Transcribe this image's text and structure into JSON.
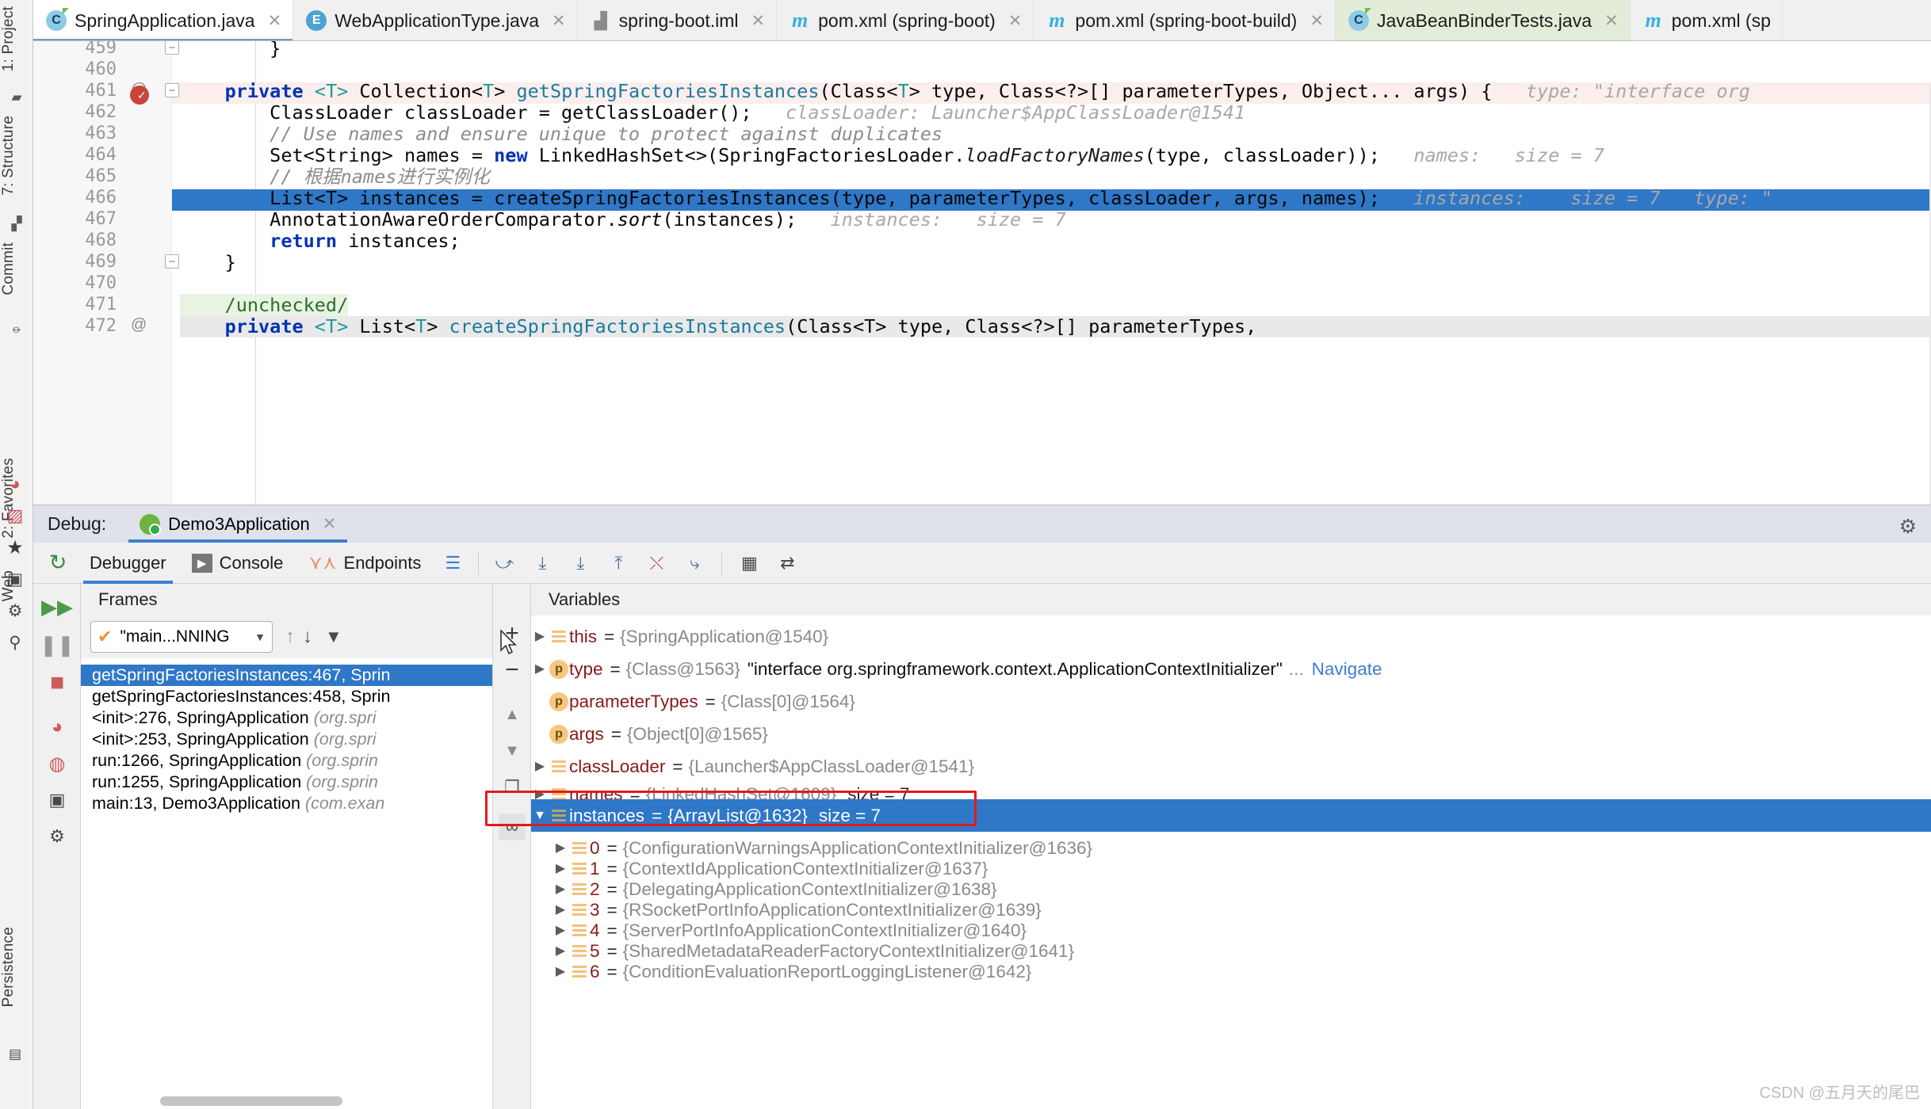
{
  "left_strip": {
    "items": [
      {
        "label": "1: Project",
        "icon": "folder-icon"
      },
      {
        "label": "7: Structure",
        "icon": "structure-icon"
      },
      {
        "label": "Commit",
        "icon": "commit-icon"
      }
    ],
    "bottom_items": [
      {
        "label": "2: Favorites",
        "icon": "star-icon"
      },
      {
        "label": "Web",
        "icon": "globe-icon"
      },
      {
        "label": "Persistence",
        "icon": "database-icon"
      }
    ],
    "bottom_icons": [
      "bug-icon",
      "coverage-icon",
      "star-icon",
      "camera-icon",
      "gear-icon",
      "pin-icon"
    ]
  },
  "tabs": [
    {
      "label": "SpringApplication.java",
      "icon": "java-class-icon",
      "active": true,
      "closable": true
    },
    {
      "label": "WebApplicationType.java",
      "icon": "java-enum-icon",
      "active": false,
      "closable": true
    },
    {
      "label": "spring-boot.iml",
      "icon": "module-icon",
      "active": false,
      "closable": true
    },
    {
      "label": "pom.xml (spring-boot)",
      "icon": "maven-icon",
      "active": false,
      "closable": true
    },
    {
      "label": "pom.xml (spring-boot-build)",
      "icon": "maven-icon",
      "active": false,
      "closable": true
    },
    {
      "label": "JavaBeanBinderTests.java",
      "icon": "java-class-icon",
      "active": false,
      "closable": true,
      "highlight": "green"
    },
    {
      "label": "pom.xml (sp",
      "icon": "maven-icon",
      "active": false,
      "closable": false
    }
  ],
  "editor": {
    "lines": [
      {
        "num": "459",
        "gutter": "",
        "fold": "minus",
        "text": "        }",
        "type": "plain"
      },
      {
        "num": "460",
        "gutter": "",
        "fold": "",
        "text": "",
        "type": "plain"
      },
      {
        "num": "461",
        "gutter": "@",
        "fold": "minus",
        "text": "    private <T> Collection<T> getSpringFactoriesInstances(Class<T> type, Class<?>[] parameterTypes, Object... args) {",
        "hint": "type:  \"interface org",
        "type": "code"
      },
      {
        "num": "462",
        "gutter": "breakpoint",
        "fold": "",
        "text": "        ClassLoader classLoader = getClassLoader();",
        "hint": "classLoader:  Launcher$AppClassLoader@1541",
        "type": "code",
        "rowbg": "#fbeeed"
      },
      {
        "num": "463",
        "gutter": "",
        "fold": "",
        "text": "        // Use names and ensure unique to protect against duplicates",
        "type": "comment"
      },
      {
        "num": "464",
        "gutter": "",
        "fold": "",
        "text": "        Set<String> names = new LinkedHashSet<>(SpringFactoriesLoader.loadFactoryNames(type, classLoader));",
        "hint": "names:   size = 7",
        "type": "code"
      },
      {
        "num": "465",
        "gutter": "",
        "fold": "",
        "text": "        // 根据names进行实例化",
        "type": "comment"
      },
      {
        "num": "466",
        "gutter": "",
        "fold": "",
        "text": "        List<T> instances = createSpringFactoriesInstances(type, parameterTypes, classLoader, args, names);",
        "hint": "instances:    size = 7   type: \"",
        "type": "code"
      },
      {
        "num": "467",
        "gutter": "",
        "fold": "",
        "text": "        AnnotationAwareOrderComparator.sort(instances);",
        "hint": "instances:   size = 7",
        "type": "code",
        "selected": true
      },
      {
        "num": "468",
        "gutter": "",
        "fold": "",
        "text": "        return instances;",
        "type": "code"
      },
      {
        "num": "469",
        "gutter": "",
        "fold": "minus",
        "text": "    }",
        "type": "plain"
      },
      {
        "num": "470",
        "gutter": "",
        "fold": "",
        "text": "",
        "type": "plain"
      },
      {
        "num": "471",
        "gutter": "",
        "fold": "",
        "text": "    /unchecked/",
        "type": "annotation"
      },
      {
        "num": "472",
        "gutter": "@",
        "fold": "",
        "text": "    private <T> List<T> createSpringFactoriesInstances(Class<T> type, Class<?>[] parameterTypes,",
        "type": "code"
      }
    ]
  },
  "debug": {
    "label": "Debug:",
    "session_tab": "Demo3Application",
    "gear_icon": "settings-gear-icon",
    "tabs": [
      {
        "label": "Debugger",
        "icon": "",
        "active": true
      },
      {
        "label": "Console",
        "icon": "console-icon",
        "active": false
      },
      {
        "label": "Endpoints",
        "icon": "endpoints-icon",
        "active": false
      }
    ],
    "toolbar_icons": [
      "layout-icon",
      "step-over-icon",
      "step-into-icon",
      "force-step-into-icon",
      "step-out-icon",
      "drop-frame-icon",
      "run-to-cursor-icon",
      "evaluate-icon",
      "settings-list-icon"
    ],
    "rail_icons": [
      "rerun-icon",
      "resume-icon",
      "pause-icon",
      "stop-icon",
      "view-breakpoints-icon",
      "mute-breakpoints-icon",
      "layout-settings-icon",
      "help-icon"
    ],
    "frames": {
      "title": "Frames",
      "thread": "\"main...NNING",
      "thread_check_icon": "check-icon",
      "dropdown_icon": "chevron-down-icon",
      "nav_icons": [
        "arrow-up-icon",
        "arrow-down-icon",
        "filter-icon"
      ],
      "items": [
        {
          "method": "getSpringFactoriesInstances:467, Sprin",
          "pkg": "",
          "selected": true
        },
        {
          "method": "getSpringFactoriesInstances:458, Sprin",
          "pkg": "",
          "selected": false
        },
        {
          "method": "<init>:276, SpringApplication ",
          "pkg": "(org.spri",
          "selected": false
        },
        {
          "method": "<init>:253, SpringApplication ",
          "pkg": "(org.spri",
          "selected": false
        },
        {
          "method": "run:1266, SpringApplication ",
          "pkg": "(org.sprin",
          "selected": false
        },
        {
          "method": "run:1255, SpringApplication ",
          "pkg": "(org.sprin",
          "selected": false
        },
        {
          "method": "main:13, Demo3Application ",
          "pkg": "(com.exan",
          "selected": false
        }
      ],
      "side_buttons": [
        "add-icon",
        "remove-icon",
        "move-up-icon",
        "move-down-icon",
        "copy-icon",
        "watch-icon"
      ]
    },
    "variables": {
      "title": "Variables",
      "rows": [
        {
          "indent": 0,
          "expandable": true,
          "expanded": false,
          "icon": "stack-icon",
          "name": "this",
          "value": "{SpringApplication@1540}"
        },
        {
          "indent": 0,
          "expandable": true,
          "expanded": false,
          "icon": "param-icon",
          "name": "type",
          "value": "{Class@1563}",
          "str": "\"interface org.springframework.context.ApplicationContextInitializer\"",
          "dots": "...",
          "link": "Navigate"
        },
        {
          "indent": 0,
          "expandable": false,
          "expanded": false,
          "icon": "param-icon",
          "name": "parameterTypes",
          "value": "{Class[0]@1564}"
        },
        {
          "indent": 0,
          "expandable": false,
          "expanded": false,
          "icon": "param-icon",
          "name": "args",
          "value": "{Object[0]@1565}"
        },
        {
          "indent": 0,
          "expandable": true,
          "expanded": false,
          "icon": "stack-icon",
          "name": "classLoader",
          "value": "{Launcher$AppClassLoader@1541}"
        },
        {
          "indent": 0,
          "expandable": true,
          "expanded": false,
          "icon": "stack-icon",
          "name": "names",
          "value": "{LinkedHashSet@1609}",
          "size": "size = 7"
        },
        {
          "indent": 0,
          "expandable": true,
          "expanded": true,
          "icon": "stack-icon",
          "name": "instances",
          "value": "{ArrayList@1632}",
          "size": "size = 7",
          "selected": true,
          "outlined": true
        },
        {
          "indent": 1,
          "expandable": true,
          "expanded": false,
          "icon": "stack-icon",
          "name": "0",
          "value": "{ConfigurationWarningsApplicationContextInitializer@1636}"
        },
        {
          "indent": 1,
          "expandable": true,
          "expanded": false,
          "icon": "stack-icon",
          "name": "1",
          "value": "{ContextIdApplicationContextInitializer@1637}"
        },
        {
          "indent": 1,
          "expandable": true,
          "expanded": false,
          "icon": "stack-icon",
          "name": "2",
          "value": "{DelegatingApplicationContextInitializer@1638}"
        },
        {
          "indent": 1,
          "expandable": true,
          "expanded": false,
          "icon": "stack-icon",
          "name": "3",
          "value": "{RSocketPortInfoApplicationContextInitializer@1639}"
        },
        {
          "indent": 1,
          "expandable": true,
          "expanded": false,
          "icon": "stack-icon",
          "name": "4",
          "value": "{ServerPortInfoApplicationContextInitializer@1640}"
        },
        {
          "indent": 1,
          "expandable": true,
          "expanded": false,
          "icon": "stack-icon",
          "name": "5",
          "value": "{SharedMetadataReaderFactoryContextInitializer@1641}"
        },
        {
          "indent": 1,
          "expandable": true,
          "expanded": false,
          "icon": "stack-icon",
          "name": "6",
          "value": "{ConditionEvaluationReportLoggingListener@1642}"
        }
      ]
    }
  },
  "watermark": "CSDN @五月天的尾巴",
  "colors": {
    "selection_blue": "#2f77c7",
    "accent_blue": "#3c7fd0",
    "highlight_red": "#e01b1b",
    "breakpoint_red": "#d0473f",
    "keyword_blue": "#0033b3",
    "type_teal": "#20999d",
    "comment_gray": "#8c8c8c",
    "hint_gray": "#a8a8a8"
  }
}
